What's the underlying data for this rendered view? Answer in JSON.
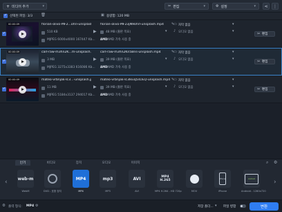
{
  "toolbar": {
    "add_media_label": "미디어 추가",
    "edit_label": "편집",
    "settings_label": "설정"
  },
  "selection": {
    "selected_label": "선택된 파일: 3/3",
    "capacity_label": "용량합: 120 MB"
  },
  "files": [
    {
      "duration": "00:00:09",
      "input_name": "florian-olivo-MF2...ohri-unsplash.jpg",
      "input_size": "510 KB",
      "input_detail": "MJPEG 6000x4000 167447 Kb...",
      "output_name": "florian-olivo-MF23jN9ohrI-unsplash.mp4",
      "output_size": "48 MB (출판 목표)",
      "output_detail": "AMD 가속 사용 중",
      "subtitle": "자막 없음",
      "audio": "오디오 없음",
      "edit_label": "편집"
    },
    {
      "duration": "00:00:09",
      "input_name": "carl-raw-m3hn2K...m-unsplash.jpg",
      "input_size": "3 MB",
      "input_detail": "MJPEG 3275x3383 616086 Kb...",
      "output_name": "carl-raw-m3hn2Kn5Bns-unsplash.mp4",
      "output_size": "39 MB (출판 목표)",
      "output_detail": "AMD 가속 사용 중",
      "subtitle": "자막 없음",
      "audio": "오디오 없음",
      "edit_label": "편집"
    },
    {
      "duration": "00:00:09",
      "input_name": "mateo-vrbnjak-Ic3...-unsplash.jpg",
      "input_size": "11 MB",
      "input_detail": "MJPEG 5184x3137 294017 Kb...",
      "output_name": "mateo-vrbnjak-Ic3Ikvq5sOEQ-unsplash.mp4",
      "output_size": "39 MB (출판 목표)",
      "output_detail": "AMD 가속 사용 중",
      "subtitle": "자막 없음",
      "audio": "오디오 없음",
      "edit_label": "편집"
    }
  ],
  "tabs": [
    "인기",
    "비디오",
    "장치",
    "오디오",
    "이미지"
  ],
  "formats": [
    {
      "icon": "web-m",
      "label": "WebM"
    },
    {
      "icon": "dvd",
      "label": "DVD - 호환 장치"
    },
    {
      "icon": "MP4",
      "label": "MP4"
    },
    {
      "icon": "mp3",
      "label": "MP3"
    },
    {
      "icon": "AVI",
      "label": "AVI"
    },
    {
      "icon": "MP4 H.265",
      "label": "MP4 H.264 - HD 720p"
    },
    {
      "icon": "MOV",
      "label": "MOV"
    },
    {
      "icon": "iPhone",
      "label": "iPhone"
    },
    {
      "icon": "Android",
      "label": "Android - 1280x720"
    }
  ],
  "footer": {
    "output_label": "출력 형식:",
    "output_value": "MP4",
    "save_label": "저장 폴더...",
    "merge_label": "파일 병합",
    "convert_label": "변환"
  },
  "colors": {
    "accent": "#2f7df3",
    "selected_format": "#1f6fd8",
    "background": "#1b2029"
  }
}
